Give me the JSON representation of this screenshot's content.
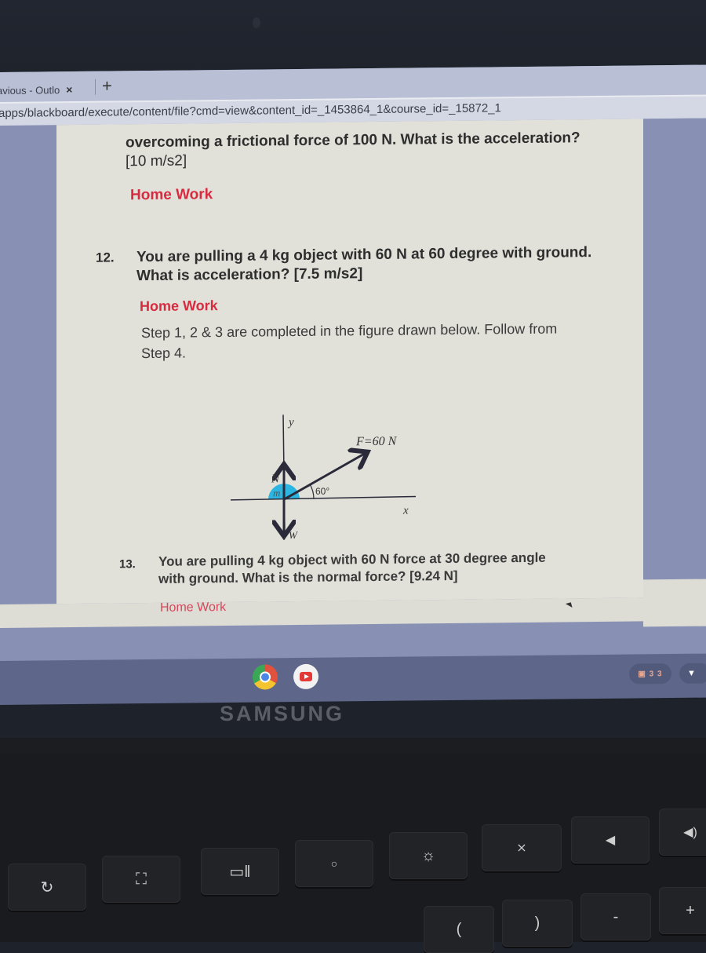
{
  "browser": {
    "tab_title": "avious - Outlo",
    "tab_close": "×",
    "new_tab": "+",
    "url": "apps/blackboard/execute/content/file?cmd=view&content_id=_1453864_1&course_id=_15872_1"
  },
  "document": {
    "q11": {
      "text_line1": "overcoming a frictional force of 100 N. What is the acceleration?",
      "text_line2": "[10 m/s2]",
      "homework": "Home Work"
    },
    "q12": {
      "number": "12.",
      "text_line1": "You are pulling a 4 kg object with 60 N at 60 degree with ground.",
      "text_line2": "What is acceleration? [7.5 m/s2]",
      "homework": "Home Work",
      "step_line1": "Step 1, 2 & 3 are completed in the figure drawn below. Follow from",
      "step_line2": "Step 4."
    },
    "diagram": {
      "y_label": "y",
      "x_label": "x",
      "force_label": "F=60 N",
      "normal_label": "N",
      "weight_label": "W",
      "mass_label": "m",
      "angle_label": "60°",
      "mass_color": "#2bb5e0"
    },
    "q13": {
      "number": "13.",
      "text_line1": "You are pulling 4 kg object with 60 N force at 30 degree angle",
      "text_line2": "with ground. What is the normal force? [9.24 N]",
      "homework": "Home Work"
    }
  },
  "shelf": {
    "apps": [
      "chrome-icon",
      "youtube-icon"
    ],
    "status": "▣ 3 3",
    "wifi": "▼"
  },
  "hardware": {
    "brand": "SAMSUNG",
    "keys": [
      "C",
      "▣",
      "▭||",
      "○",
      "☼",
      "🔇",
      "🔉",
      "🔊",
      "+",
      "-",
      "(",
      ")"
    ]
  },
  "colors": {
    "homework_red": "#d72b3f",
    "shelf": "#5e668a",
    "page_bg": "#e1e1da"
  }
}
